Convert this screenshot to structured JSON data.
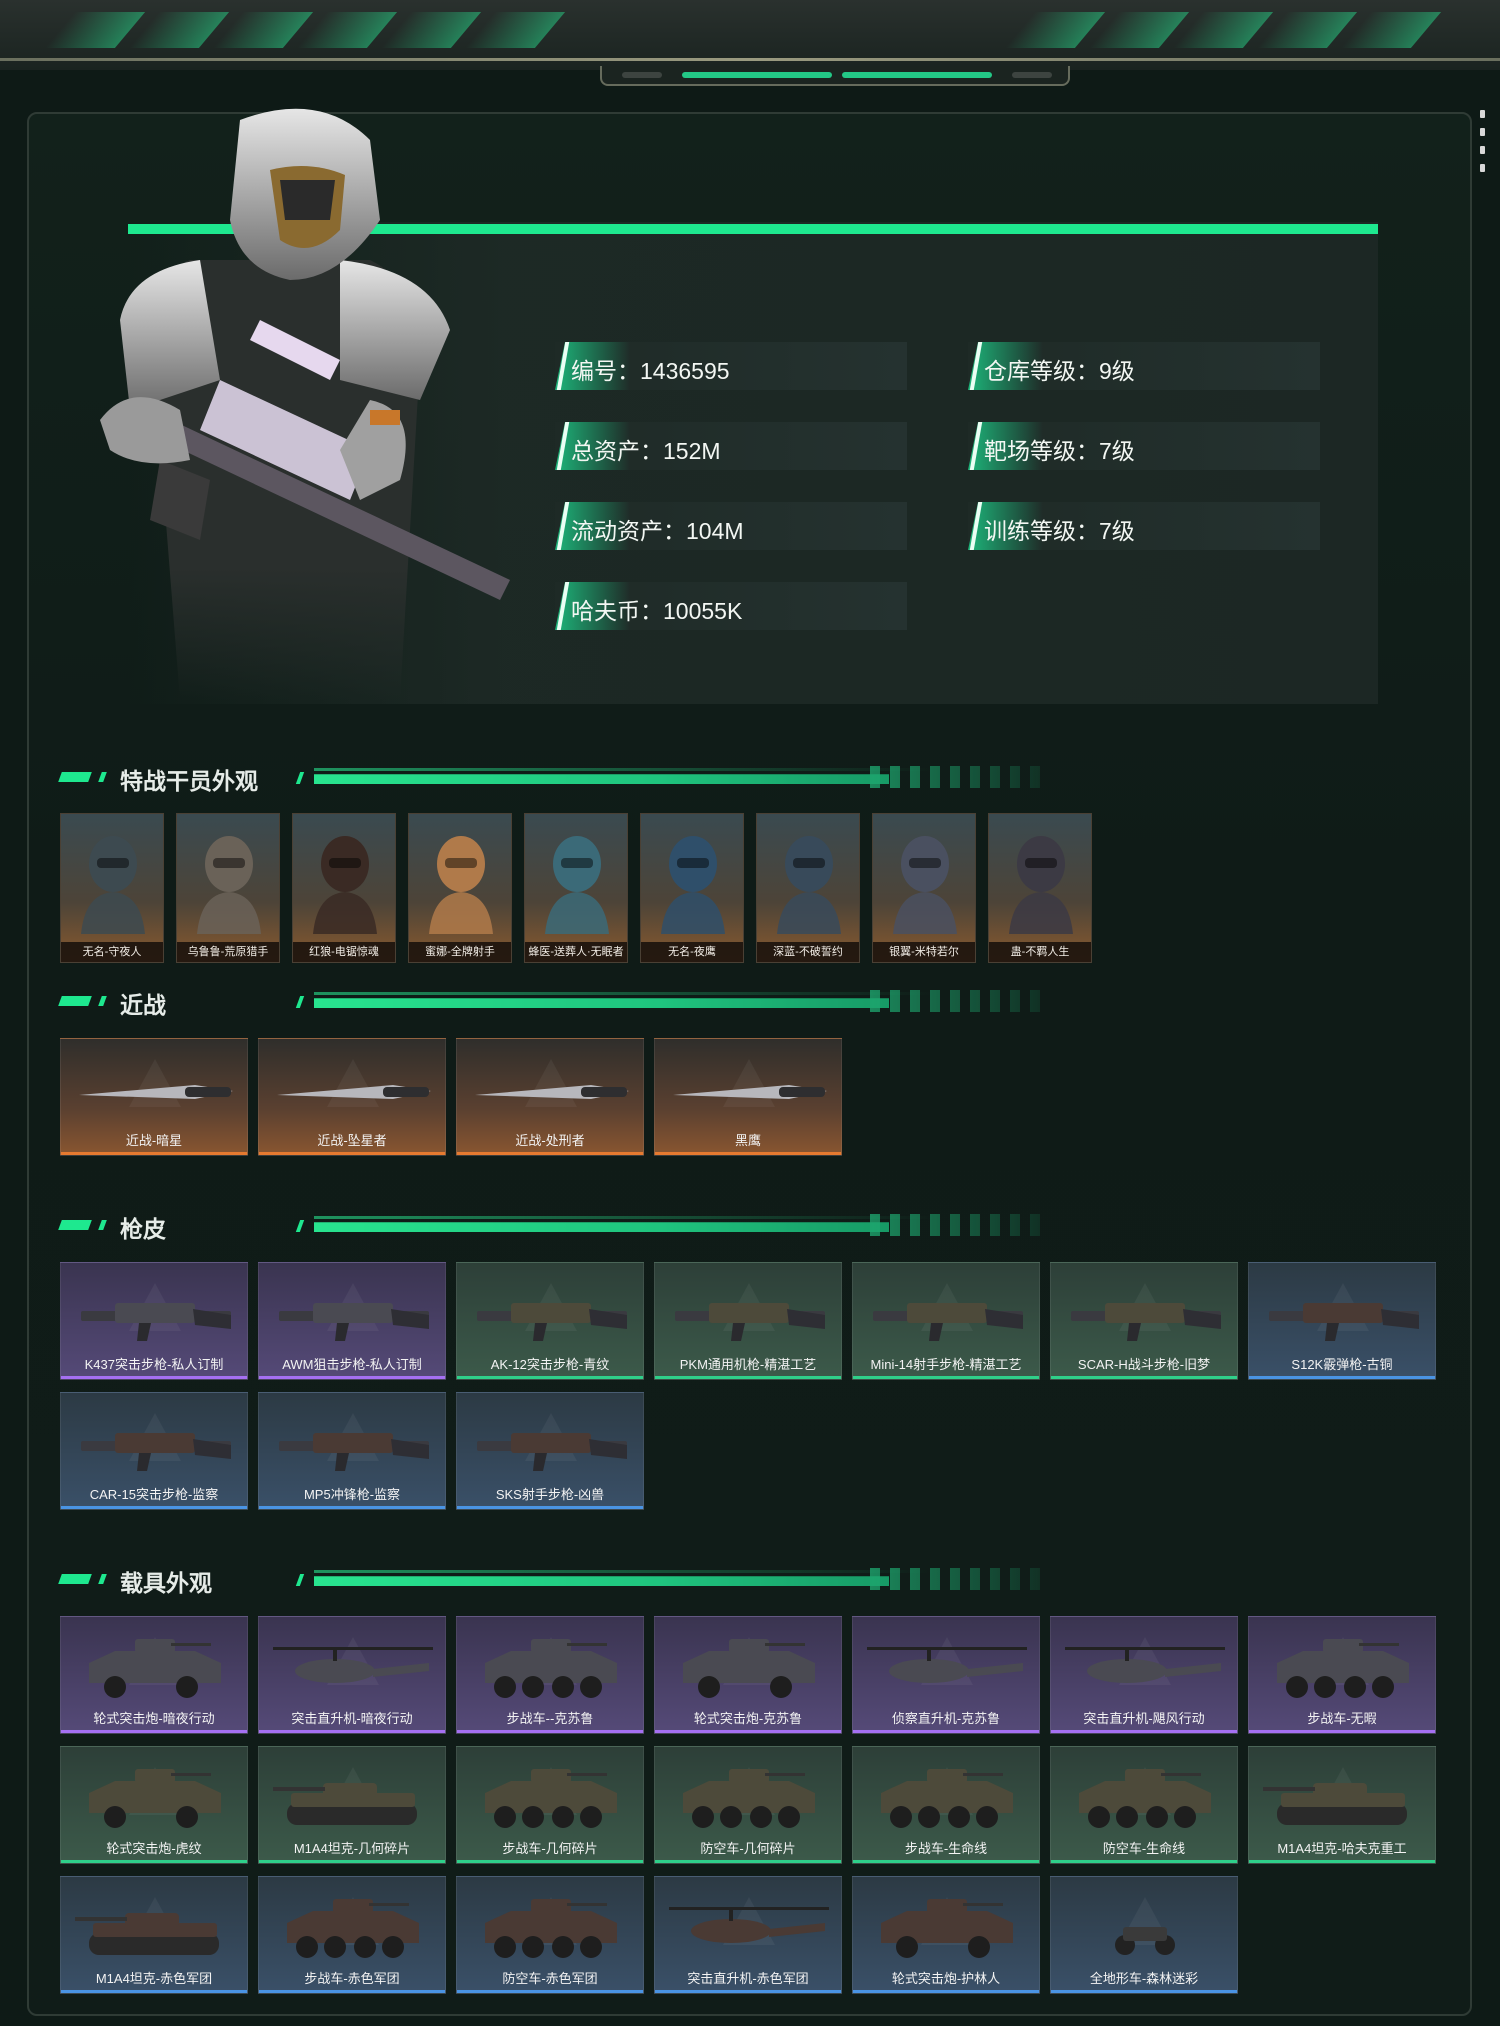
{
  "profile": {
    "stats_left": [
      {
        "label": "编号：1436595"
      },
      {
        "label": "总资产：152M"
      },
      {
        "label": "流动资产：104M"
      },
      {
        "label": "哈夫币：10055K"
      }
    ],
    "stats_right": [
      {
        "label": "仓库等级：9级"
      },
      {
        "label": "靶场等级：7级"
      },
      {
        "label": "训练等级：7级"
      }
    ]
  },
  "sections": {
    "operators": "特战干员外观",
    "melee": "近战",
    "guns": "枪皮",
    "vehicles": "载具外观"
  },
  "operators": [
    {
      "label": "无名-守夜人"
    },
    {
      "label": "乌鲁鲁-荒原猎手"
    },
    {
      "label": "红狼-电锯惊魂"
    },
    {
      "label": "蜜娜-全牌射手"
    },
    {
      "label": "蜂医-送葬人·无眠者"
    },
    {
      "label": "无名-夜鹰"
    },
    {
      "label": "深蓝-不破誓约"
    },
    {
      "label": "银翼-米特若尔"
    },
    {
      "label": "蛊-不羁人生"
    }
  ],
  "melee": [
    {
      "label": "近战-暗星",
      "rarity": "orange"
    },
    {
      "label": "近战-坠星者",
      "rarity": "orange"
    },
    {
      "label": "近战-处刑者",
      "rarity": "orange"
    },
    {
      "label": "黑鹰",
      "rarity": "orange"
    }
  ],
  "guns": [
    {
      "label": "K437突击步枪-私人订制",
      "rarity": "purple"
    },
    {
      "label": "AWM狙击步枪-私人订制",
      "rarity": "purple"
    },
    {
      "label": "AK-12突击步枪-青纹",
      "rarity": "green"
    },
    {
      "label": "PKM通用机枪-精湛工艺",
      "rarity": "green"
    },
    {
      "label": "Mini-14射手步枪-精湛工艺",
      "rarity": "green"
    },
    {
      "label": "SCAR-H战斗步枪-旧梦",
      "rarity": "green"
    },
    {
      "label": "S12K霰弹枪-古铜",
      "rarity": "blue"
    },
    {
      "label": "CAR-15突击步枪-监察",
      "rarity": "blue"
    },
    {
      "label": "MP5冲锋枪-监察",
      "rarity": "blue"
    },
    {
      "label": "SKS射手步枪-凶兽",
      "rarity": "blue"
    }
  ],
  "vehicles": [
    {
      "label": "轮式突击炮-暗夜行动",
      "rarity": "purple",
      "kind": "car"
    },
    {
      "label": "突击直升机-暗夜行动",
      "rarity": "purple",
      "kind": "heli"
    },
    {
      "label": "步战车--克苏鲁",
      "rarity": "purple",
      "kind": "apc"
    },
    {
      "label": "轮式突击炮-克苏鲁",
      "rarity": "purple",
      "kind": "car"
    },
    {
      "label": "侦察直升机-克苏鲁",
      "rarity": "purple",
      "kind": "heli"
    },
    {
      "label": "突击直升机-飓风行动",
      "rarity": "purple",
      "kind": "heli"
    },
    {
      "label": "步战车-无暇",
      "rarity": "purple",
      "kind": "apc"
    },
    {
      "label": "轮式突击炮-虎纹",
      "rarity": "green",
      "kind": "car"
    },
    {
      "label": "M1A4坦克-几何碎片",
      "rarity": "green",
      "kind": "tank"
    },
    {
      "label": "步战车-几何碎片",
      "rarity": "green",
      "kind": "apc"
    },
    {
      "label": "防空车-几何碎片",
      "rarity": "green",
      "kind": "apc"
    },
    {
      "label": "步战车-生命线",
      "rarity": "green",
      "kind": "apc"
    },
    {
      "label": "防空车-生命线",
      "rarity": "green",
      "kind": "apc"
    },
    {
      "label": "M1A4坦克-哈夫克重工",
      "rarity": "green",
      "kind": "tank"
    },
    {
      "label": "M1A4坦克-赤色军团",
      "rarity": "blue",
      "kind": "tank"
    },
    {
      "label": "步战车-赤色军团",
      "rarity": "blue",
      "kind": "apc"
    },
    {
      "label": "防空车-赤色军团",
      "rarity": "blue",
      "kind": "apc"
    },
    {
      "label": "突击直升机-赤色军团",
      "rarity": "blue",
      "kind": "heli"
    },
    {
      "label": "轮式突击炮-护林人",
      "rarity": "blue",
      "kind": "car"
    },
    {
      "label": "全地形车-森林迷彩",
      "rarity": "blue",
      "kind": "atv"
    }
  ],
  "colors": {
    "accent": "#1ee88f",
    "orange": "#e67a30",
    "purple": "#a570f2",
    "green": "#2fd08a",
    "blue": "#4a94e4"
  }
}
